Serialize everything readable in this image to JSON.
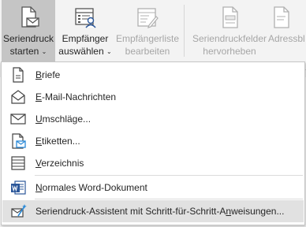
{
  "ribbon": {
    "mail_merge": {
      "line1": "Seriendruck",
      "line2": "starten",
      "icon": "mail-merge-icon"
    },
    "recipients": {
      "line1": "Empfänger",
      "line2": "auswählen",
      "icon": "select-recipients-icon"
    },
    "edit_list": {
      "line1": "Empfängerliste",
      "line2": "bearbeiten",
      "icon": "edit-recipient-list-icon"
    },
    "highlight_fields": {
      "line1": "Seriendruckfelder",
      "line2": "hervorheben",
      "icon": "highlight-merge-fields-icon"
    },
    "address_block": {
      "line1": "Adressbl",
      "icon": "address-block-icon"
    },
    "caret": "⌄"
  },
  "menu": {
    "items": [
      {
        "pre": "",
        "key": "B",
        "post": "riefe",
        "icon": "letter-icon"
      },
      {
        "pre": "",
        "key": "E",
        "post": "-Mail-Nachrichten",
        "icon": "email-icon"
      },
      {
        "pre": "",
        "key": "U",
        "post": "mschläge...",
        "icon": "envelope-icon"
      },
      {
        "pre": "",
        "key": "E",
        "post": "tiketten...",
        "icon": "labels-icon"
      },
      {
        "pre": "",
        "key": "V",
        "post": "erzeichnis",
        "icon": "directory-icon"
      },
      {
        "pre": "",
        "key": "N",
        "post": "ormales Word-Dokument",
        "icon": "word-document-icon"
      },
      {
        "pre": "Seriendruck-Assistent mit Schritt-für-Schritt-A",
        "key": "n",
        "post": "weisungen...",
        "icon": "wizard-icon"
      }
    ]
  },
  "colors": {
    "accent": "#2b579a",
    "highlight": "#e1e1e1",
    "pressed": "#c5c5c5"
  }
}
